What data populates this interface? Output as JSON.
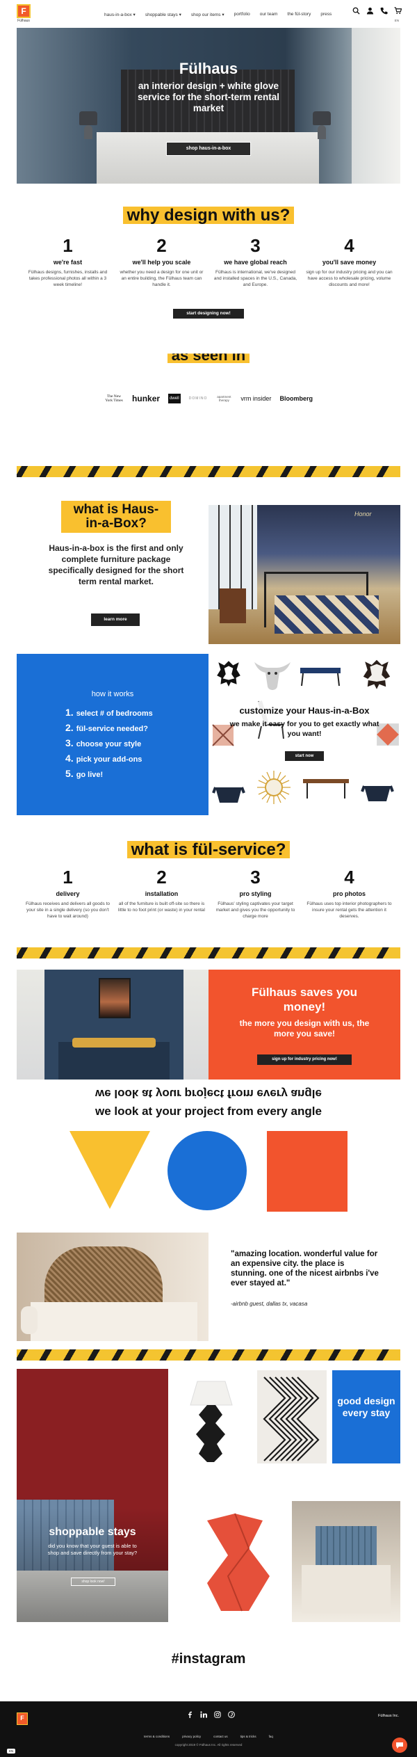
{
  "header": {
    "logo_text": "F",
    "logo_caption": "Fülhaus",
    "nav": [
      "haus-in-a-box",
      "shoppable stays",
      "shop our items",
      "portfolio",
      "our team",
      "the fül-story",
      "press"
    ],
    "language": "EN"
  },
  "hero": {
    "title": "Fülhaus",
    "subtitle": "an interior design + white glove service for the short-term rental market",
    "button": "shop haus-in-a-box"
  },
  "why": {
    "title": "why design with us?",
    "items": [
      {
        "num": "1",
        "title": "we're fast",
        "desc": "Fülhaus designs, furnishes, installs and takes professional photos all within a 3 week timeline!"
      },
      {
        "num": "2",
        "title": "we'll help you scale",
        "desc": "whether you need a design for one unit or an entire building, the Fülhaus team can handle it."
      },
      {
        "num": "3",
        "title": "we have global reach",
        "desc": "Fülhaus is international, we've designed and installed spaces in the U.S., Canada, and Europe."
      },
      {
        "num": "4",
        "title": "you'll save money",
        "desc": "sign up for our industry pricing and you can have access to wholesale pricing, volume discounts and more!"
      }
    ],
    "button": "start designing now!"
  },
  "press": {
    "title": "as seen in",
    "logos": [
      "The New York Times",
      "hunker",
      "dwell",
      "DOMINO",
      "apartment therapy",
      "vrm insider",
      "Bloomberg"
    ]
  },
  "hib": {
    "title": "what is Haus-in-a-Box?",
    "text": "Haus-in-a-box is the first and only complete furniture package specifically designed for the short term rental market.",
    "button": "learn more",
    "neon": "Honor"
  },
  "how": {
    "title": "how it works",
    "steps": [
      {
        "n": "1.",
        "label": "select # of bedrooms"
      },
      {
        "n": "2.",
        "label": "fül-service needed?"
      },
      {
        "n": "3.",
        "label": "choose your style"
      },
      {
        "n": "4.",
        "label": "pick your add-ons"
      },
      {
        "n": "5.",
        "label": "go live!"
      }
    ]
  },
  "customize": {
    "title": "customize your Haus-in-a-Box",
    "subtitle": "we make it easy for you to get exactly what you want!",
    "button": "start now"
  },
  "service": {
    "title": "what is fül-service?",
    "items": [
      {
        "num": "1",
        "title": "delivery",
        "desc": "Fülhaus receives and delivers all goods to your site in a single delivery (so you don't have to wait around)"
      },
      {
        "num": "2",
        "title": "installation",
        "desc": "all of the furniture is built off-site so there is little to no foot print (or waste) in your rental"
      },
      {
        "num": "3",
        "title": "pro styling",
        "desc": "Fülhaus' styling captivates your target market and gives you the opportunity to charge more"
      },
      {
        "num": "4",
        "title": "pro photos",
        "desc": "Fülhaus uses top interior photographers to insure your rental gets the attention it deserves."
      }
    ]
  },
  "saves": {
    "title": "Fülhaus saves you money!",
    "subtitle": "the more you design with us, the more you save!",
    "button": "sign up for industry pricing now!"
  },
  "look": {
    "title": "we look at your project from every angle"
  },
  "testimonial": {
    "quote": "\"amazing location. wonderful value for an expensive city. the place is stunning. one of the nicest airbnbs i've ever stayed at.\"",
    "author": "-airbnb guest, dallas tx, vacasa"
  },
  "shop": {
    "title": "shoppable stays",
    "text": "did you know that your guest is able to shop and save directly from your stay?",
    "button": "shop look now!",
    "good": "good design every stay"
  },
  "instagram": {
    "title": "#instagram"
  },
  "footer": {
    "logo_text": "F",
    "brand": "Fülhaus Inc.",
    "links": [
      "terms & conditions",
      "privacy policy",
      "contact us",
      "tips & tricks",
      "faq"
    ],
    "copyright": "copyright 2019 © Fülhaus Inc. All rights reserved",
    "lang_badge": "EN"
  },
  "colors": {
    "yellow": "#f9c02f",
    "blue": "#1a6fd6",
    "orange": "#f2542d",
    "black": "#111111"
  }
}
